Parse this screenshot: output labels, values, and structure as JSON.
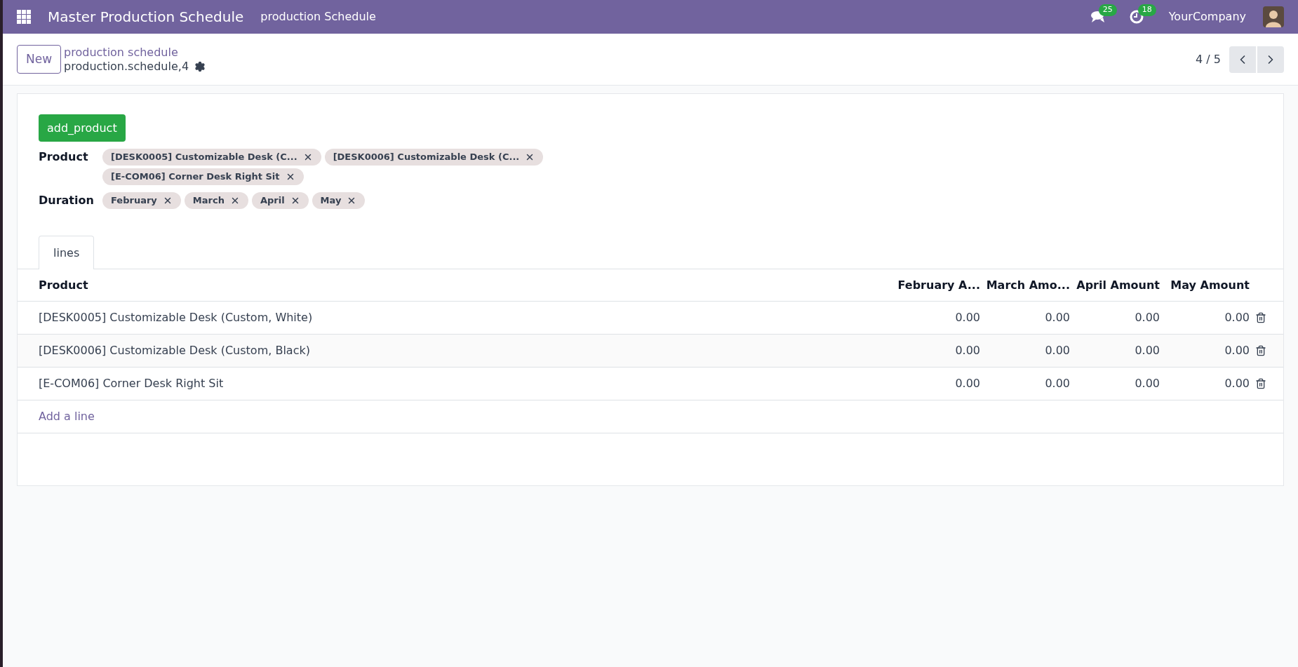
{
  "navbar": {
    "app_title": "Master Production Schedule",
    "menu": "production Schedule",
    "messages_count": "25",
    "activities_count": "18",
    "company": "YourCompany"
  },
  "control_panel": {
    "new_button": "New",
    "breadcrumb": "production schedule",
    "record_name": "production.schedule,4",
    "pager": "4 / 5"
  },
  "form": {
    "action_button": "add_product",
    "fields": [
      {
        "label": "Product",
        "tags": [
          "[DESK0005] Customizable Desk (C...",
          "[DESK0006] Customizable Desk (C...",
          "[E-COM06] Corner Desk Right Sit"
        ]
      },
      {
        "label": "Duration",
        "tags": [
          "February",
          "March",
          "April",
          "May"
        ]
      }
    ],
    "tabs": [
      {
        "label": "lines",
        "selected": true
      }
    ],
    "table": {
      "columns": [
        "Product",
        "February A...",
        "March Amo...",
        "April Amount",
        "May Amount"
      ],
      "rows": [
        {
          "cells": [
            "[DESK0005] Customizable Desk (Custom, White)",
            "0.00",
            "0.00",
            "0.00",
            "0.00"
          ]
        },
        {
          "cells": [
            "[DESK0006] Customizable Desk (Custom, Black)",
            "0.00",
            "0.00",
            "0.00",
            "0.00"
          ]
        },
        {
          "cells": [
            "[E-COM06] Corner Desk Right Sit",
            "0.00",
            "0.00",
            "0.00",
            "0.00"
          ]
        }
      ],
      "add_line": "Add a line"
    }
  }
}
